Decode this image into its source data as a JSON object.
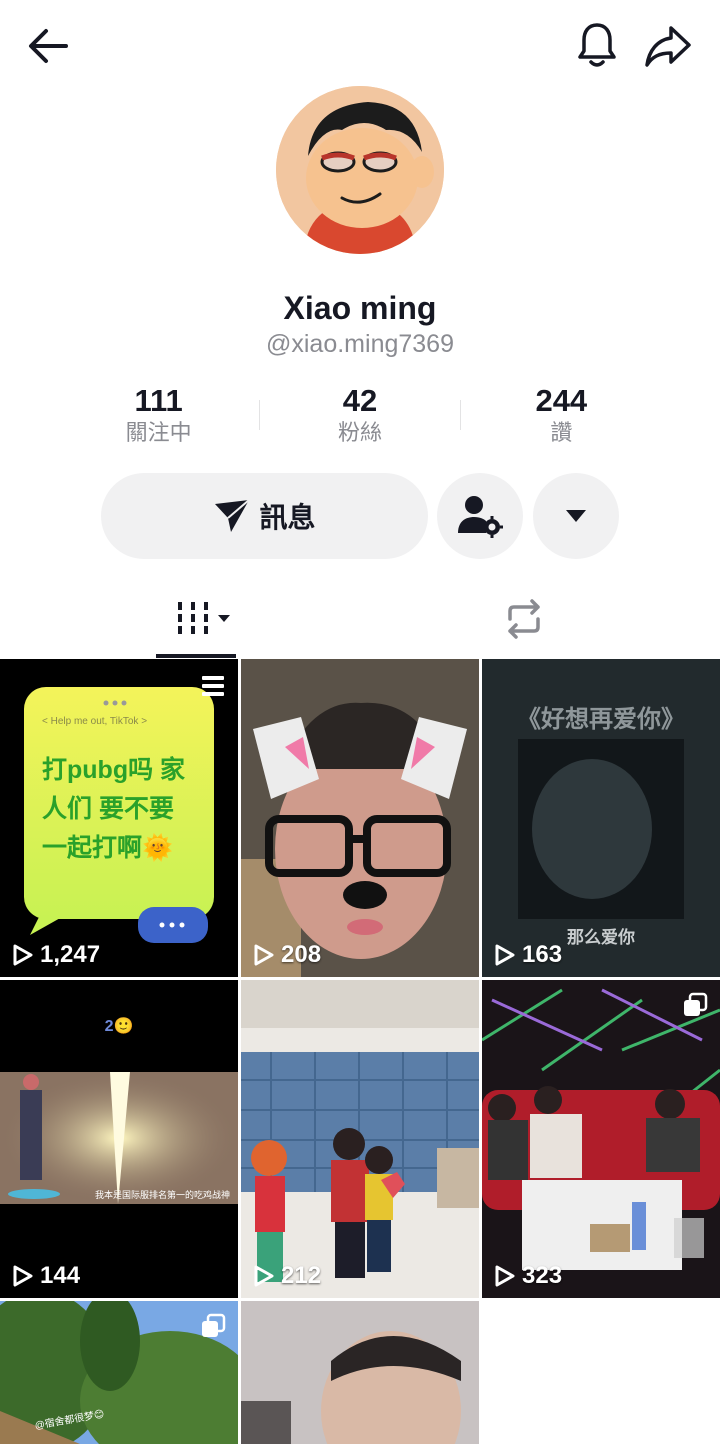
{
  "profile": {
    "name": "Xiao ming",
    "handle": "@xiao.ming7369"
  },
  "stats": [
    {
      "value": "111",
      "label": "關注中"
    },
    {
      "value": "42",
      "label": "粉絲"
    },
    {
      "value": "244",
      "label": "讚"
    }
  ],
  "actions": {
    "message_label": "訊息"
  },
  "videos": [
    {
      "views": "1,247",
      "caption_small": "< Help me out, TikTok >",
      "caption": "打pubg吗 家人们 要不要 一起打啊🌞"
    },
    {
      "views": "208"
    },
    {
      "views": "163",
      "title": "《好想再爱你》",
      "subtitle": "那么爱你"
    },
    {
      "views": "144",
      "top_text": "2🙂",
      "caption": "我本是国际服排名第一的吃鸡战神"
    },
    {
      "views": "212"
    },
    {
      "views": "323"
    },
    {
      "views": "",
      "caption": "@宿舍都很梦😊"
    },
    {
      "views": ""
    }
  ],
  "colors": {
    "text": "#161823",
    "muted": "#8a8b91",
    "button_bg": "#f1f1f2"
  }
}
